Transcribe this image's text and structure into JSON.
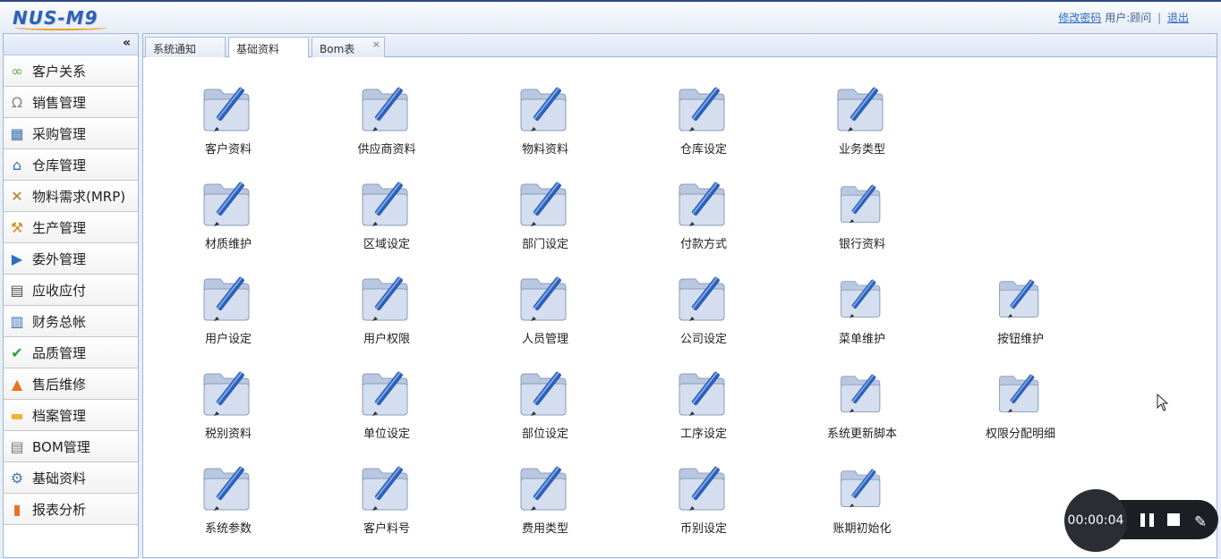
{
  "app": {
    "logo_text": "NUS-M9"
  },
  "header": {
    "change_password": "修改密码",
    "user_label": "用户:顾问",
    "separator": "|",
    "logout": "退出"
  },
  "sidebar": {
    "collapse_icon": "«",
    "items": [
      {
        "label": "客户关系",
        "icon": "handshake-icon"
      },
      {
        "label": "销售管理",
        "icon": "headset-icon"
      },
      {
        "label": "采购管理",
        "icon": "cart-icon"
      },
      {
        "label": "仓库管理",
        "icon": "warehouse-icon"
      },
      {
        "label": "物料需求(MRP)",
        "icon": "tools-icon"
      },
      {
        "label": "生产管理",
        "icon": "wrench-icon"
      },
      {
        "label": "委外管理",
        "icon": "truck-icon"
      },
      {
        "label": "应收应付",
        "icon": "calculator-icon"
      },
      {
        "label": "财务总帐",
        "icon": "ledger-icon"
      },
      {
        "label": "品质管理",
        "icon": "shield-check-icon"
      },
      {
        "label": "售后维修",
        "icon": "warning-icon"
      },
      {
        "label": "档案管理",
        "icon": "folder-icon"
      },
      {
        "label": "BOM管理",
        "icon": "document-icon"
      },
      {
        "label": "基础资料",
        "icon": "gear-icon"
      },
      {
        "label": "报表分析",
        "icon": "bar-chart-icon"
      }
    ]
  },
  "tabs": [
    {
      "label": "系统通知",
      "active": false
    },
    {
      "label": "基础资料",
      "active": true
    },
    {
      "label": "Bom表",
      "active": false,
      "close": "×"
    }
  ],
  "grid": {
    "rows": [
      [
        "客户资料",
        "供应商资料",
        "物料资料",
        "仓库设定",
        "业务类型"
      ],
      [
        "材质维护",
        "区域设定",
        "部门设定",
        "付款方式",
        "银行资料"
      ],
      [
        "用户设定",
        "用户权限",
        "人员管理",
        "公司设定",
        "菜单维护",
        "按钮维护"
      ],
      [
        "税别资料",
        "单位设定",
        "部位设定",
        "工序设定",
        "系统更新脚本",
        "权限分配明细"
      ],
      [
        "系统参数",
        "客户料号",
        "费用类型",
        "币别设定",
        "账期初始化"
      ]
    ]
  },
  "recorder": {
    "time": "00:00:04"
  },
  "colors": {
    "accent": "#2e6cc4",
    "border": "#9fb6d8",
    "folder": "#a9bad6",
    "pen": "#2b5fb8"
  }
}
